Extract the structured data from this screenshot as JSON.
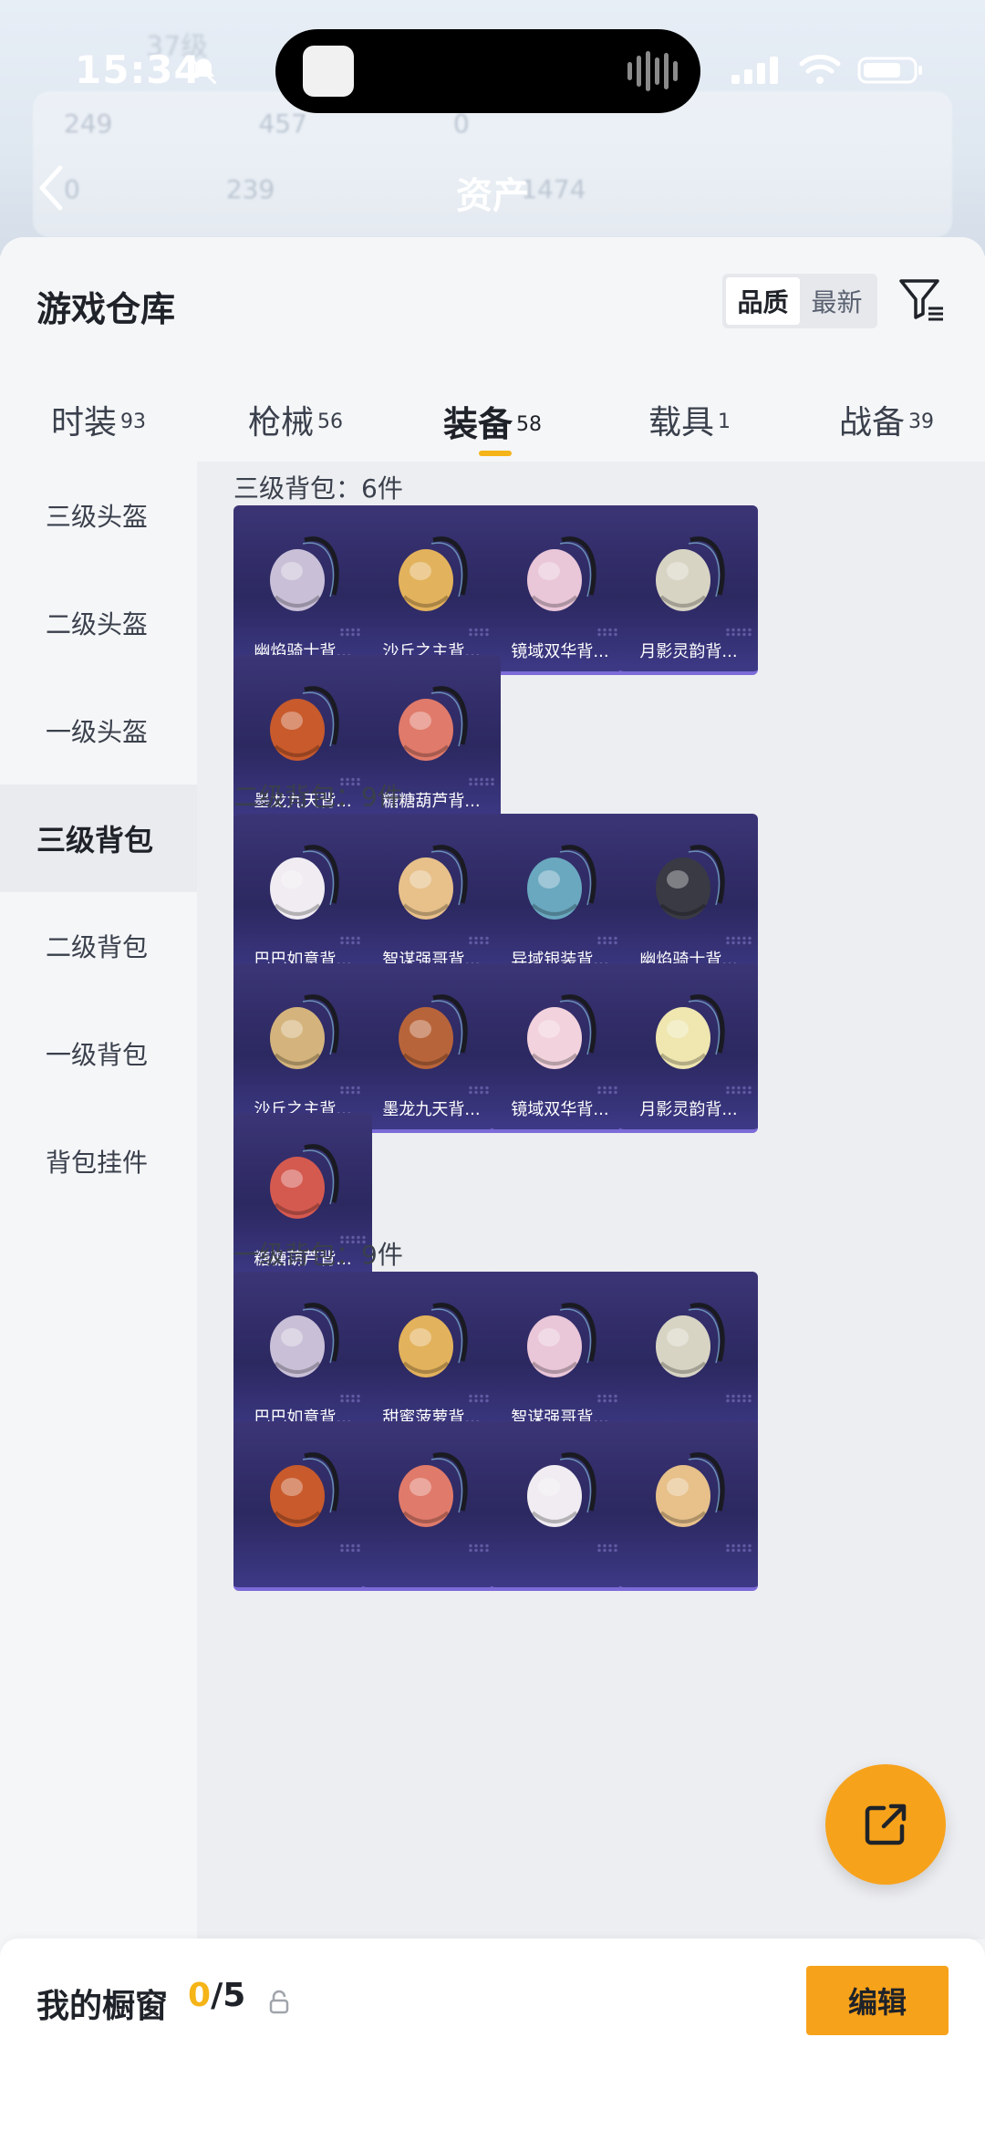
{
  "status": {
    "time": "15:34"
  },
  "background": {
    "title": "资产",
    "ghost_level": "37级",
    "ghost_values": [
      "249",
      "457",
      "0",
      "0",
      "239",
      "1474"
    ]
  },
  "sheet": {
    "title": "游戏仓库",
    "sort": {
      "options": [
        "品质",
        "最新"
      ],
      "selected": "品质"
    }
  },
  "tabs": [
    {
      "label": "时装",
      "count": "93"
    },
    {
      "label": "枪械",
      "count": "56"
    },
    {
      "label": "装备",
      "count": "58",
      "active": true
    },
    {
      "label": "载具",
      "count": "1"
    },
    {
      "label": "战备",
      "count": "39"
    }
  ],
  "sidebar": [
    {
      "label": "三级头盔"
    },
    {
      "label": "二级头盔"
    },
    {
      "label": "一级头盔"
    },
    {
      "label": "三级背包",
      "active": true
    },
    {
      "label": "二级背包"
    },
    {
      "label": "一级背包"
    },
    {
      "label": "背包挂件"
    }
  ],
  "sections": [
    {
      "title": "三级背包：6件",
      "items": [
        "幽焰骑士背...",
        "沙丘之主背...",
        "镜域双华背...",
        "月影灵韵背...",
        "墨龙九天背...",
        "糖糖葫芦背..."
      ]
    },
    {
      "title": "二级背包：9件",
      "items": [
        "巴巴如意背...",
        "智谋强哥背...",
        "异域银装背...",
        "幽焰骑士背...",
        "沙丘之主背...",
        "墨龙九天背...",
        "镜域双华背...",
        "月影灵韵背...",
        "糖糖葫芦背..."
      ]
    },
    {
      "title": "一级背包：9件",
      "items": [
        "巴巴如意背...",
        "甜蜜菠萝背...",
        "智谋强哥背...",
        "",
        "",
        "",
        "",
        ""
      ]
    }
  ],
  "bottom": {
    "showcase_label": "我的橱窗",
    "showcase_current": "0",
    "showcase_total": "/5",
    "edit_label": "编辑"
  },
  "colors": {
    "accent": "#f5b417",
    "button": "#f7a21b",
    "card": "#2c2860"
  }
}
